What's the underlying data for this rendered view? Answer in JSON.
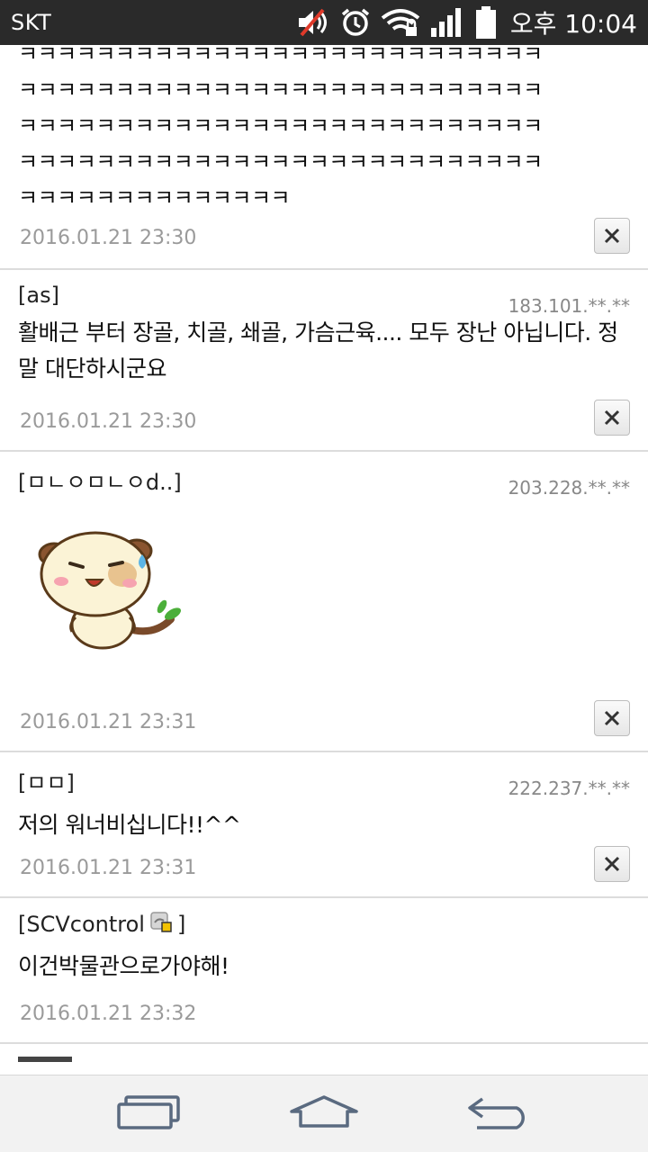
{
  "statusbar": {
    "carrier": "SKT",
    "time": "오후 10:04",
    "icons": [
      "muted-icon",
      "alarm-icon",
      "wifi-icon",
      "signal-icon",
      "battery-icon"
    ]
  },
  "comments": [
    {
      "author": "",
      "ip": "",
      "text_lines": [
        "ㅋㅋㅋㅋㅋㅋㅋㅋㅋㅋㅋㅋㅋㅋㅋㅋㅋㅋㅋㅋㅋㅋㅋㅋㅋㅋㅋ",
        "ㅋㅋㅋㅋㅋㅋㅋㅋㅋㅋㅋㅋㅋㅋㅋㅋㅋㅋㅋㅋㅋㅋㅋㅋㅋㅋㅋ",
        "ㅋㅋㅋㅋㅋㅋㅋㅋㅋㅋㅋㅋㅋㅋㅋㅋㅋㅋㅋㅋㅋㅋㅋㅋㅋㅋㅋ",
        "ㅋㅋㅋㅋㅋㅋㅋㅋㅋㅋㅋㅋㅋㅋㅋㅋㅋㅋㅋㅋㅋㅋㅋㅋㅋㅋㅋ",
        "ㅋㅋㅋㅋㅋㅋㅋㅋㅋㅋㅋㅋㅋㅋ"
      ],
      "date": "2016.01.21 23:30"
    },
    {
      "author": "[as]",
      "ip": "183.101.**.**",
      "text": "활배근 부터 장골, 치골, 쇄골, 가슴근육.... 모두 장난 아닙니다. 정말 대단하시군요",
      "date": "2016.01.21 23:30"
    },
    {
      "author": "[ㅁㄴㅇㅁㄴㅇd..]",
      "ip": "203.228.**.**",
      "sticker": "puppy-sticker",
      "date": "2016.01.21 23:31"
    },
    {
      "author": "[ㅁㅁ]",
      "ip": "222.237.**.**",
      "text": "저의 워너비십니다!!^^",
      "date": "2016.01.21 23:31"
    },
    {
      "author": "[SCVcontrol",
      "author_suffix": "]",
      "author_badge": "member-badge-icon",
      "ip": "",
      "text": "이건박물관으로가야해!",
      "date": "2016.01.21 23:32"
    }
  ],
  "navbar": {
    "buttons": [
      "recent-apps-button",
      "home-button",
      "back-button"
    ]
  },
  "colors": {
    "statusbar_bg": "#2a2a2a",
    "divider": "#dcdcdc",
    "date_text": "#9a9a9a",
    "navbar_bg": "#f2f2f2"
  }
}
